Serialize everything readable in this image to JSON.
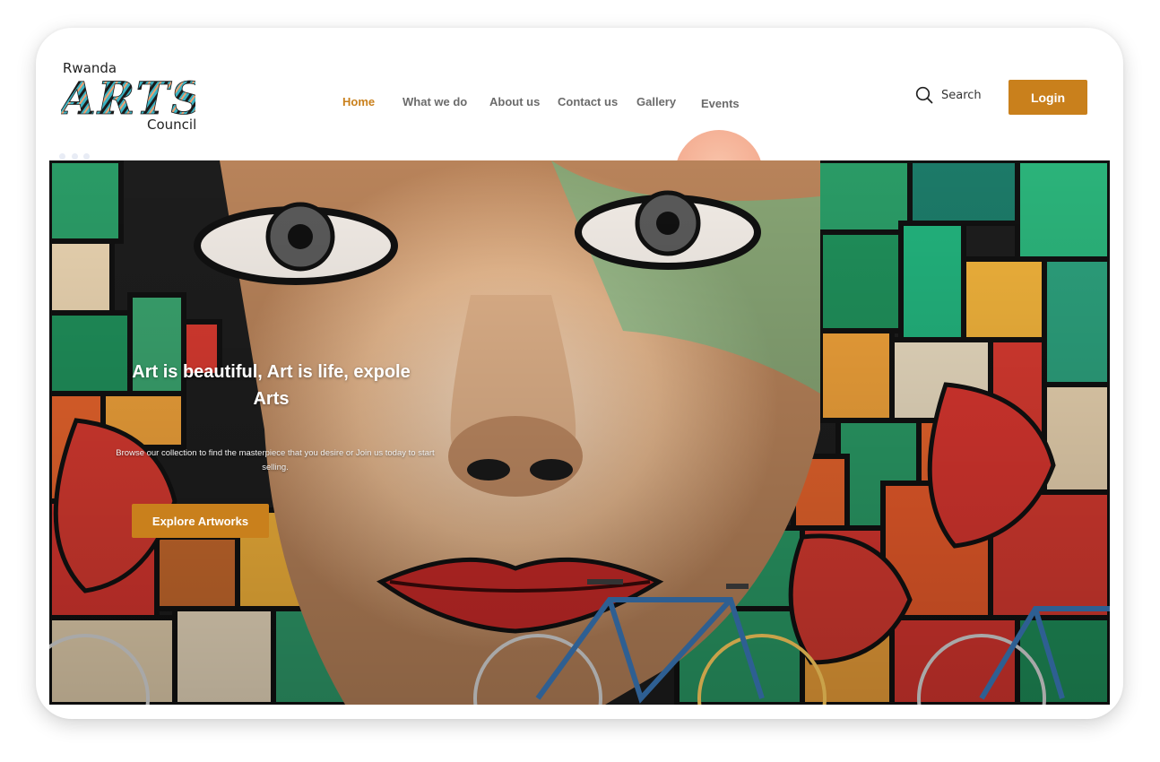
{
  "brand": {
    "line1": "Rwanda",
    "line2": "ARTS",
    "line3": "Council"
  },
  "nav": {
    "items": [
      {
        "label": "Home",
        "active": true
      },
      {
        "label": "What we do",
        "active": false
      },
      {
        "label": "About us",
        "active": false
      },
      {
        "label": "Contact us",
        "active": false
      },
      {
        "label": "Gallery",
        "active": false
      },
      {
        "label": "Events",
        "active": false
      }
    ]
  },
  "search": {
    "label": "Search",
    "icon": "search-icon"
  },
  "login": {
    "label": "Login"
  },
  "hero": {
    "title": "Art is beautiful, Art is life, expole Arts",
    "subtitle": "Browse our collection to find the masterpiece that you desire or Join us today to start selling.",
    "cta_label": "Explore Artworks",
    "image": "street-mural-with-bicycles"
  },
  "colors": {
    "accent": "#c9801c",
    "nav_text": "#6b6b6b"
  }
}
